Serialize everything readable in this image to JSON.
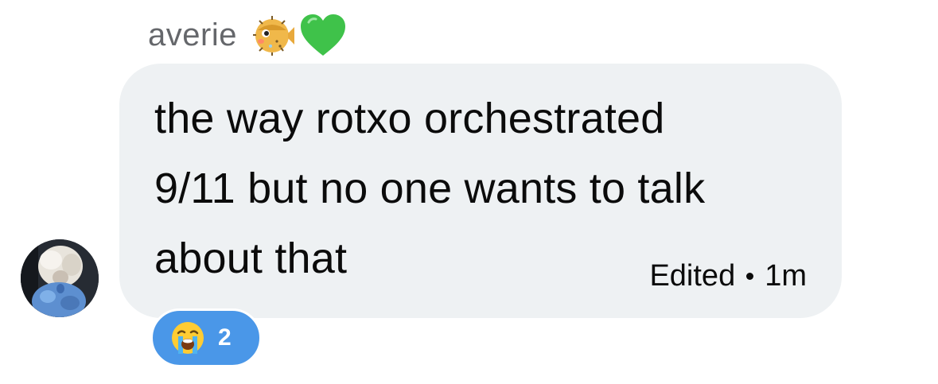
{
  "message": {
    "sender_name": "averie",
    "sender_emojis": [
      "blowfish-icon",
      "green-heart-icon"
    ],
    "lines": [
      "the way rotxo orchestrated",
      "9/11 but no one wants to talk",
      "about that"
    ],
    "edited_label": "Edited",
    "time": "1m",
    "reaction": {
      "emoji": "loudly-crying-face-icon",
      "count": "2",
      "color": "#4a97e8"
    }
  },
  "colors": {
    "bubble": "#eef1f3",
    "sender_name": "#65676b",
    "text": "#0b0b0b"
  }
}
